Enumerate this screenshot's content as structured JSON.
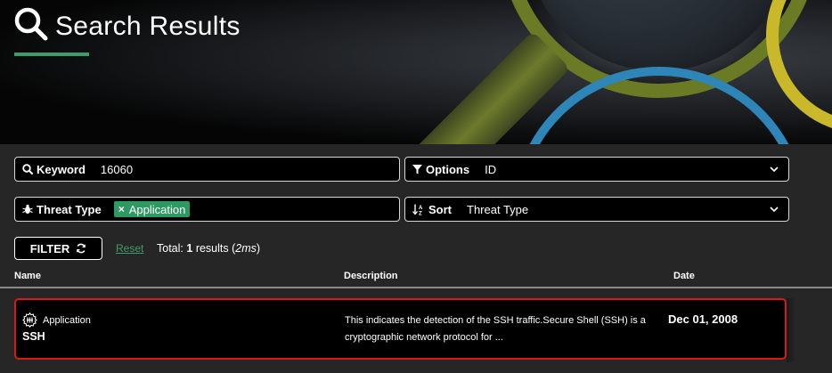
{
  "header": {
    "title": "Search Results"
  },
  "filters": {
    "keyword": {
      "label": "Keyword",
      "value": "16060"
    },
    "options": {
      "label": "Options",
      "value": "ID"
    },
    "threat_type": {
      "label": "Threat Type",
      "tags": [
        "Application"
      ]
    },
    "sort": {
      "label": "Sort",
      "value": "Threat Type"
    }
  },
  "actions": {
    "filter_label": "FILTER",
    "reset_label": "Reset",
    "total_prefix": "Total:",
    "total_count": "1",
    "total_suffix": "results (",
    "total_time": "2ms",
    "total_close": ")"
  },
  "table": {
    "columns": [
      "Name",
      "Description",
      "Date"
    ],
    "rows": [
      {
        "type": "Application",
        "name": "SSH",
        "description": "This indicates the detection of the SSH traffic.Secure Shell (SSH) is a cryptographic network protocol for ...",
        "date": "Dec 01, 2008"
      }
    ]
  },
  "colors": {
    "accent": "#3c9d6a",
    "highlight_border": "#d71a1a",
    "background": "#262626"
  },
  "icons": [
    "search-icon",
    "funnel-icon",
    "bug-icon",
    "sort-az-icon",
    "chevron-down-icon",
    "refresh-icon",
    "app-icon"
  ]
}
